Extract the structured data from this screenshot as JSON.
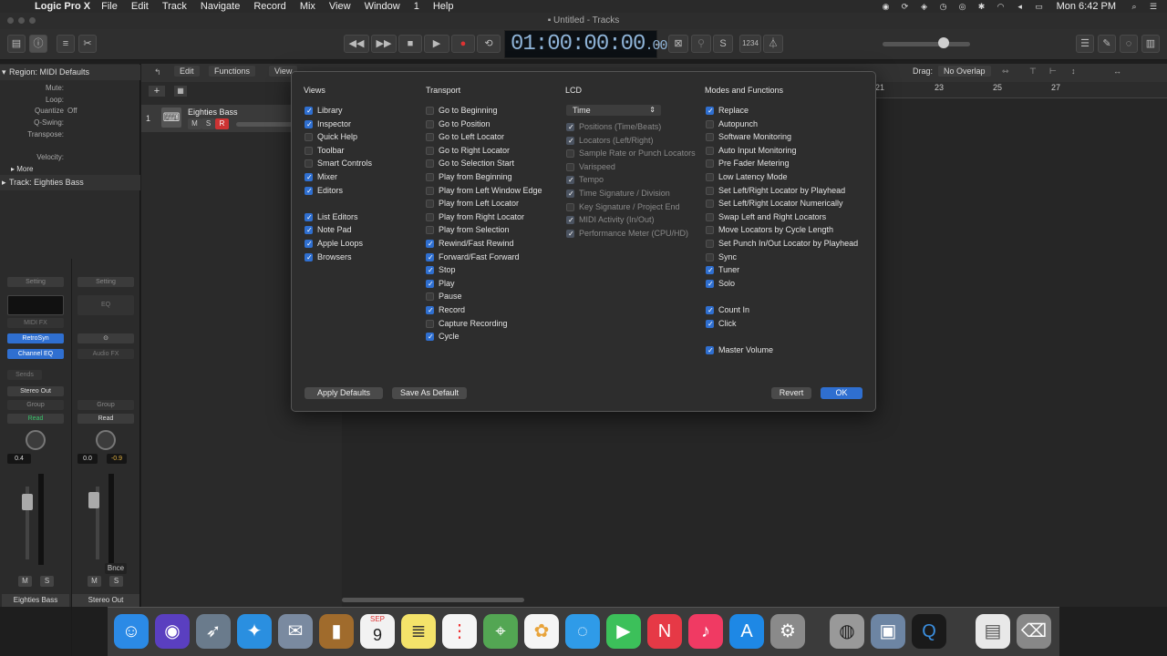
{
  "menubar": {
    "app_name": "Logic Pro X",
    "items": [
      "File",
      "Edit",
      "Track",
      "Navigate",
      "Record",
      "Mix",
      "View",
      "Window",
      "1",
      "Help"
    ],
    "clock": "Mon 6:42 PM"
  },
  "window_title": "Untitled - Tracks",
  "lcd": {
    "main": "01:00:00:00",
    "sub": ".00"
  },
  "inspector": {
    "region_header": "Region:  MIDI Defaults",
    "params": [
      {
        "label": "Mute:",
        "value": ""
      },
      {
        "label": "Loop:",
        "value": ""
      },
      {
        "label": "Quantize",
        "value": "Off"
      },
      {
        "label": "Q-Swing:",
        "value": ""
      },
      {
        "label": "Transpose:",
        "value": ""
      },
      {
        "label": "Velocity:",
        "value": ""
      }
    ],
    "more_label": "More",
    "track_header": "Track:  Eighties Bass",
    "strip1": {
      "setting": "Setting",
      "midi_fx": "MIDI FX",
      "instrument": "RetroSyn",
      "eq": "Channel EQ",
      "sends": "Sends",
      "output": "Stereo Out",
      "group": "Group",
      "automation": "Read",
      "pan_value": "0.4",
      "mute": "M",
      "solo": "S",
      "name": "Eighties Bass"
    },
    "strip2": {
      "setting": "Setting",
      "eq": "EQ",
      "audio_fx": "Audio FX",
      "group": "Group",
      "automation": "Read",
      "pan_value": "0.0",
      "level_value": "-0.9",
      "bounce": "Bnce",
      "mute": "M",
      "solo": "S",
      "name": "Stereo Out"
    }
  },
  "tracks": {
    "toolbar": {
      "edit": "Edit",
      "functions": "Functions",
      "view": "View",
      "drag_label": "Drag:",
      "drag_value": "No Overlap"
    },
    "ruler": [
      "21",
      "23",
      "25",
      "27"
    ],
    "track": {
      "number": "1",
      "name": "Eighties Bass",
      "mute": "M",
      "solo": "S",
      "record": "R"
    }
  },
  "dialog": {
    "views": {
      "title": "Views",
      "items": [
        {
          "label": "Library",
          "checked": true
        },
        {
          "label": "Inspector",
          "checked": true
        },
        {
          "label": "Quick Help",
          "checked": false
        },
        {
          "label": "Toolbar",
          "checked": false
        },
        {
          "label": "Smart Controls",
          "checked": false
        },
        {
          "label": "Mixer",
          "checked": true
        },
        {
          "label": "Editors",
          "checked": true
        },
        {
          "label": "List Editors",
          "checked": true
        },
        {
          "label": "Note Pad",
          "checked": true
        },
        {
          "label": "Apple Loops",
          "checked": true
        },
        {
          "label": "Browsers",
          "checked": true
        }
      ]
    },
    "transport": {
      "title": "Transport",
      "items": [
        {
          "label": "Go to Beginning",
          "checked": false
        },
        {
          "label": "Go to Position",
          "checked": false
        },
        {
          "label": "Go to Left Locator",
          "checked": false
        },
        {
          "label": "Go to Right Locator",
          "checked": false
        },
        {
          "label": "Go to Selection Start",
          "checked": false
        },
        {
          "label": "Play from Beginning",
          "checked": false
        },
        {
          "label": "Play from Left Window Edge",
          "checked": false
        },
        {
          "label": "Play from Left Locator",
          "checked": false
        },
        {
          "label": "Play from Right Locator",
          "checked": false
        },
        {
          "label": "Play from Selection",
          "checked": false
        },
        {
          "label": "Rewind/Fast Rewind",
          "checked": true
        },
        {
          "label": "Forward/Fast Forward",
          "checked": true
        },
        {
          "label": "Stop",
          "checked": true
        },
        {
          "label": "Play",
          "checked": true
        },
        {
          "label": "Pause",
          "checked": false
        },
        {
          "label": "Record",
          "checked": true
        },
        {
          "label": "Capture Recording",
          "checked": false
        },
        {
          "label": "Cycle",
          "checked": true
        }
      ]
    },
    "lcd": {
      "title": "LCD",
      "select_value": "Time",
      "items": [
        {
          "label": "Positions (Time/Beats)",
          "checked": true
        },
        {
          "label": "Locators (Left/Right)",
          "checked": true
        },
        {
          "label": "Sample Rate or Punch Locators",
          "checked": false
        },
        {
          "label": "Varispeed",
          "checked": false
        },
        {
          "label": "Tempo",
          "checked": true
        },
        {
          "label": "Time Signature / Division",
          "checked": true
        },
        {
          "label": "Key Signature / Project End",
          "checked": false
        },
        {
          "label": "MIDI Activity (In/Out)",
          "checked": true
        },
        {
          "label": "Performance Meter (CPU/HD)",
          "checked": true
        }
      ]
    },
    "modes": {
      "title": "Modes and Functions",
      "items": [
        {
          "label": "Replace",
          "checked": true
        },
        {
          "label": "Autopunch",
          "checked": false
        },
        {
          "label": "Software Monitoring",
          "checked": false
        },
        {
          "label": "Auto Input Monitoring",
          "checked": false
        },
        {
          "label": "Pre Fader Metering",
          "checked": false
        },
        {
          "label": "Low Latency Mode",
          "checked": false
        },
        {
          "label": "Set Left/Right Locator by Playhead",
          "checked": false
        },
        {
          "label": "Set Left/Right Locator Numerically",
          "checked": false
        },
        {
          "label": "Swap Left and Right Locators",
          "checked": false
        },
        {
          "label": "Move Locators by Cycle Length",
          "checked": false
        },
        {
          "label": "Set Punch In/Out Locator by Playhead",
          "checked": false
        },
        {
          "label": "Sync",
          "checked": false
        },
        {
          "label": "Tuner",
          "checked": true
        },
        {
          "label": "Solo",
          "checked": true
        },
        {
          "label": "Count In",
          "checked": true
        },
        {
          "label": "Click",
          "checked": true
        },
        {
          "label": "Master Volume",
          "checked": true
        }
      ]
    },
    "buttons": {
      "apply_defaults": "Apply Defaults",
      "save_default": "Save As Default",
      "revert": "Revert",
      "ok": "OK"
    }
  },
  "dock": {
    "calendar_month": "SEP",
    "calendar_day": "9"
  },
  "colors": {
    "accent": "#2f6fd0",
    "record": "#d33",
    "read": "#39c06a",
    "lcd_text": "#8fb4d8"
  }
}
